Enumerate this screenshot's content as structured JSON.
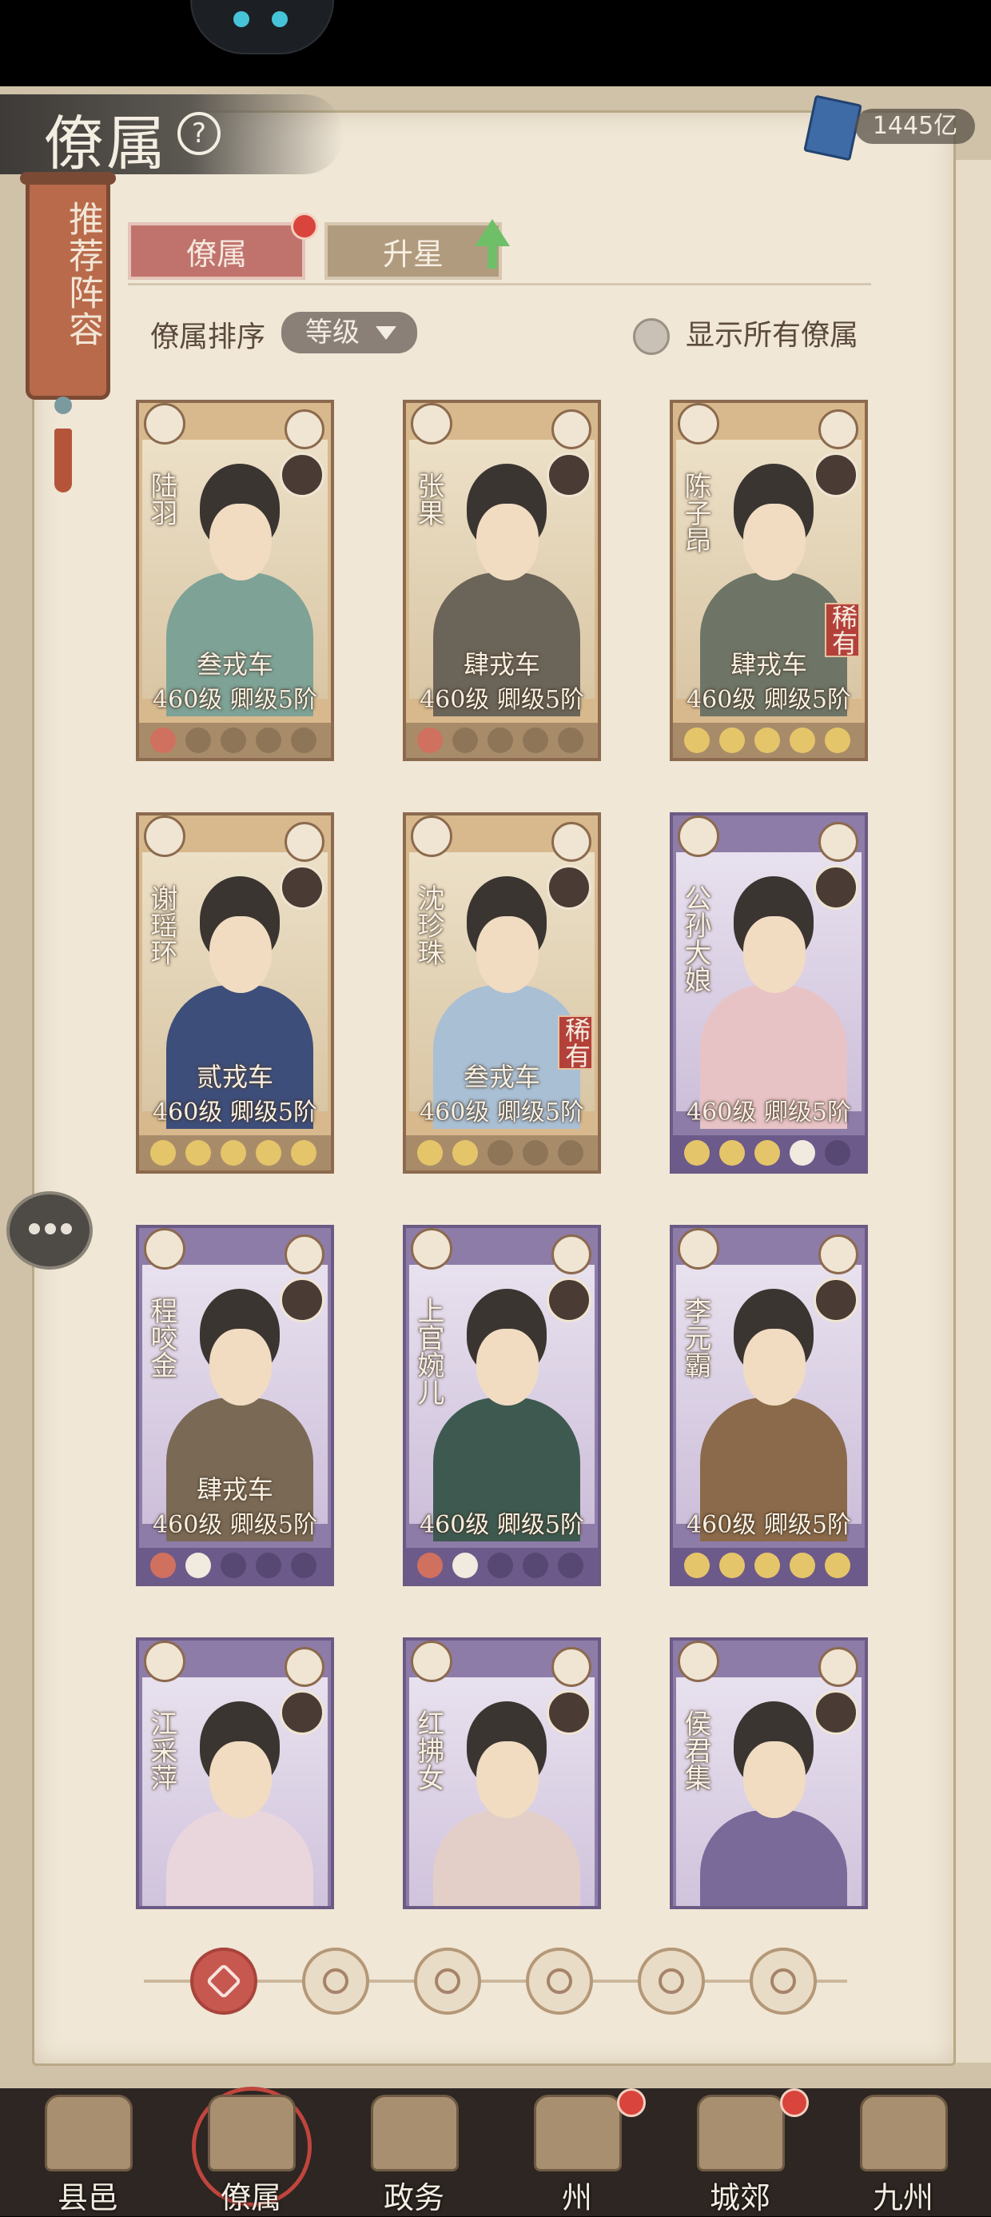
{
  "header": {
    "title": "僚属",
    "help_icon": "question-circle-icon",
    "currency_icon": "book-icon",
    "currency": "1445亿"
  },
  "banner": {
    "label": "推荐阵容"
  },
  "tabs": [
    {
      "label": "僚属",
      "active": true,
      "badge": "red-dot"
    },
    {
      "label": "升星",
      "active": false,
      "badge": "green-up-arrow"
    }
  ],
  "sort": {
    "label": "僚属排序",
    "value": "等级"
  },
  "toggle": {
    "label": "显示所有僚属",
    "checked": false
  },
  "colors": {
    "gold_frame": "#d8b98d",
    "purple_frame": "#8e7ca8",
    "active_tab": "#c0736c",
    "badge_red": "#d9443c",
    "arrow_green": "#6fbf69"
  },
  "cards": [
    {
      "name": "陆羽",
      "rank": "叁戎车",
      "level": "460级",
      "grade": "卿级5阶",
      "rare": "",
      "frame": "gold",
      "stars": [
        "red",
        "empty",
        "empty",
        "empty",
        "empty"
      ]
    },
    {
      "name": "张果",
      "rank": "肆戎车",
      "level": "460级",
      "grade": "卿级5阶",
      "rare": "",
      "frame": "gold",
      "stars": [
        "red",
        "empty",
        "empty",
        "empty",
        "empty"
      ]
    },
    {
      "name": "陈子昂",
      "rank": "肆戎车",
      "level": "460级",
      "grade": "卿级5阶",
      "rare": "稀有",
      "frame": "gold",
      "stars": [
        "gold",
        "gold",
        "gold",
        "gold",
        "gold"
      ]
    },
    {
      "name": "谢瑶环",
      "rank": "贰戎车",
      "level": "460级",
      "grade": "卿级5阶",
      "rare": "",
      "frame": "gold",
      "stars": [
        "gold",
        "gold",
        "gold",
        "gold",
        "gold"
      ]
    },
    {
      "name": "沈珍珠",
      "rank": "叁戎车",
      "level": "460级",
      "grade": "卿级5阶",
      "rare": "稀有",
      "frame": "gold",
      "stars": [
        "gold",
        "gold",
        "empty",
        "empty",
        "empty"
      ]
    },
    {
      "name": "公孙大娘",
      "rank": "",
      "level": "460级",
      "grade": "卿级5阶",
      "rare": "",
      "frame": "purple",
      "stars": [
        "gold",
        "gold",
        "gold",
        "white",
        "empty"
      ]
    },
    {
      "name": "程咬金",
      "rank": "肆戎车",
      "level": "460级",
      "grade": "卿级5阶",
      "rare": "",
      "frame": "purple",
      "stars": [
        "red",
        "white",
        "empty",
        "empty",
        "empty"
      ]
    },
    {
      "name": "上官婉儿",
      "rank": "",
      "level": "460级",
      "grade": "卿级5阶",
      "rare": "",
      "frame": "purple",
      "stars": [
        "red",
        "white",
        "empty",
        "empty",
        "empty"
      ]
    },
    {
      "name": "李元霸",
      "rank": "",
      "level": "460级",
      "grade": "卿级5阶",
      "rare": "",
      "frame": "purple",
      "stars": [
        "gold",
        "gold",
        "gold",
        "gold",
        "gold"
      ]
    },
    {
      "name": "江采萍",
      "rank": "",
      "level": "",
      "grade": "",
      "rare": "",
      "frame": "purple",
      "stars": []
    },
    {
      "name": "红拂女",
      "rank": "",
      "level": "",
      "grade": "",
      "rare": "",
      "frame": "purple",
      "stars": []
    },
    {
      "name": "侯君集",
      "rank": "",
      "level": "",
      "grade": "",
      "rare": "",
      "frame": "purple",
      "stars": []
    }
  ],
  "filters": [
    {
      "icon": "all-filter-icon",
      "active": true
    },
    {
      "icon": "bell-filter-icon",
      "active": false
    },
    {
      "icon": "gourd-filter-icon",
      "active": false
    },
    {
      "icon": "fan-filter-icon",
      "active": false
    },
    {
      "icon": "jade-filter-icon",
      "active": false
    },
    {
      "icon": "leaf-filter-icon",
      "active": false
    }
  ],
  "bottom_nav": [
    {
      "label": "县邑",
      "icon": "county-icon",
      "badge": false,
      "active": false
    },
    {
      "label": "僚属",
      "icon": "retainers-icon",
      "badge": false,
      "active": true
    },
    {
      "label": "政务",
      "icon": "affairs-icon",
      "badge": false,
      "active": false
    },
    {
      "label": "州",
      "icon": "prefecture-icon",
      "badge": true,
      "active": false
    },
    {
      "label": "城郊",
      "icon": "suburb-icon",
      "badge": true,
      "active": false
    },
    {
      "label": "九州",
      "icon": "nine-provinces-icon",
      "badge": false,
      "active": false
    }
  ]
}
